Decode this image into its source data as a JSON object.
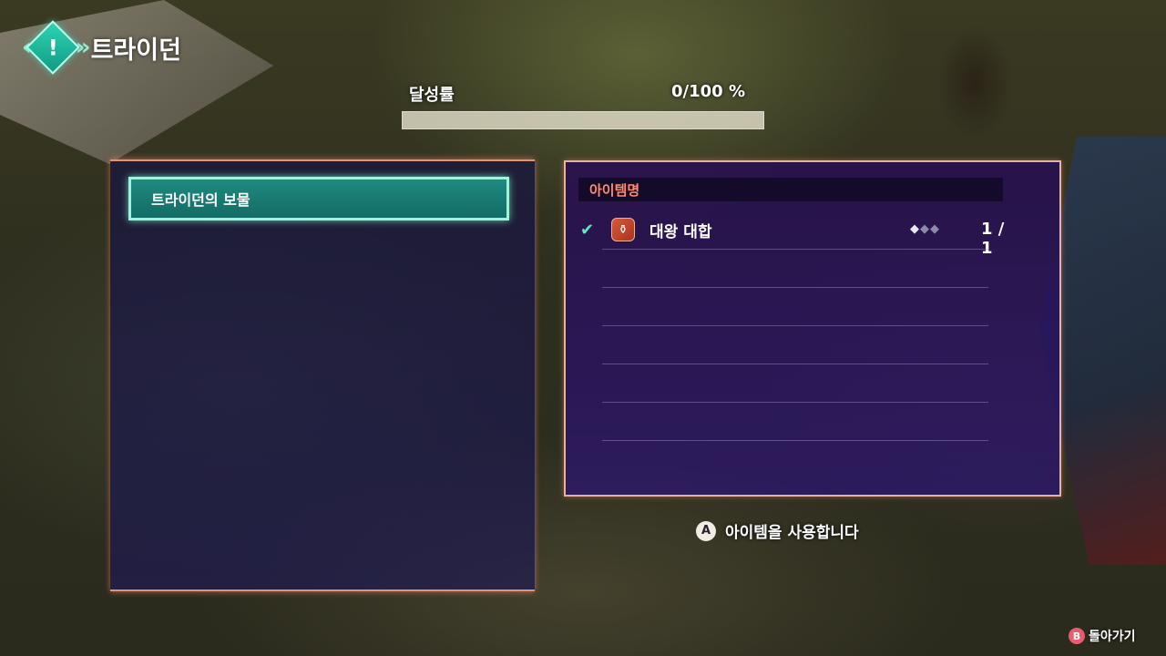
{
  "header": {
    "title": "트라이던",
    "icon": "exclamation-diamond-icon"
  },
  "completion": {
    "label": "달성률",
    "value_text": "0/100 %",
    "progress": 0
  },
  "quest_list": {
    "items": [
      {
        "label": "트라이던의 보물",
        "selected": true
      }
    ]
  },
  "item_table": {
    "header": "아이템명",
    "rows": [
      {
        "checked": true,
        "icon": "bottle-icon",
        "name": "대왕 대합",
        "rarity_filled": 1,
        "rarity_total": 3,
        "count": "1 / 1"
      }
    ]
  },
  "hints": {
    "use_button": "A",
    "use_text": "아이템을 사용합니다",
    "back_button": "B",
    "back_text": "돌아가기"
  },
  "colors": {
    "accent_teal": "#2ee0b8",
    "panel_border": "#e7b39b",
    "header_text": "#ff8a6e"
  }
}
